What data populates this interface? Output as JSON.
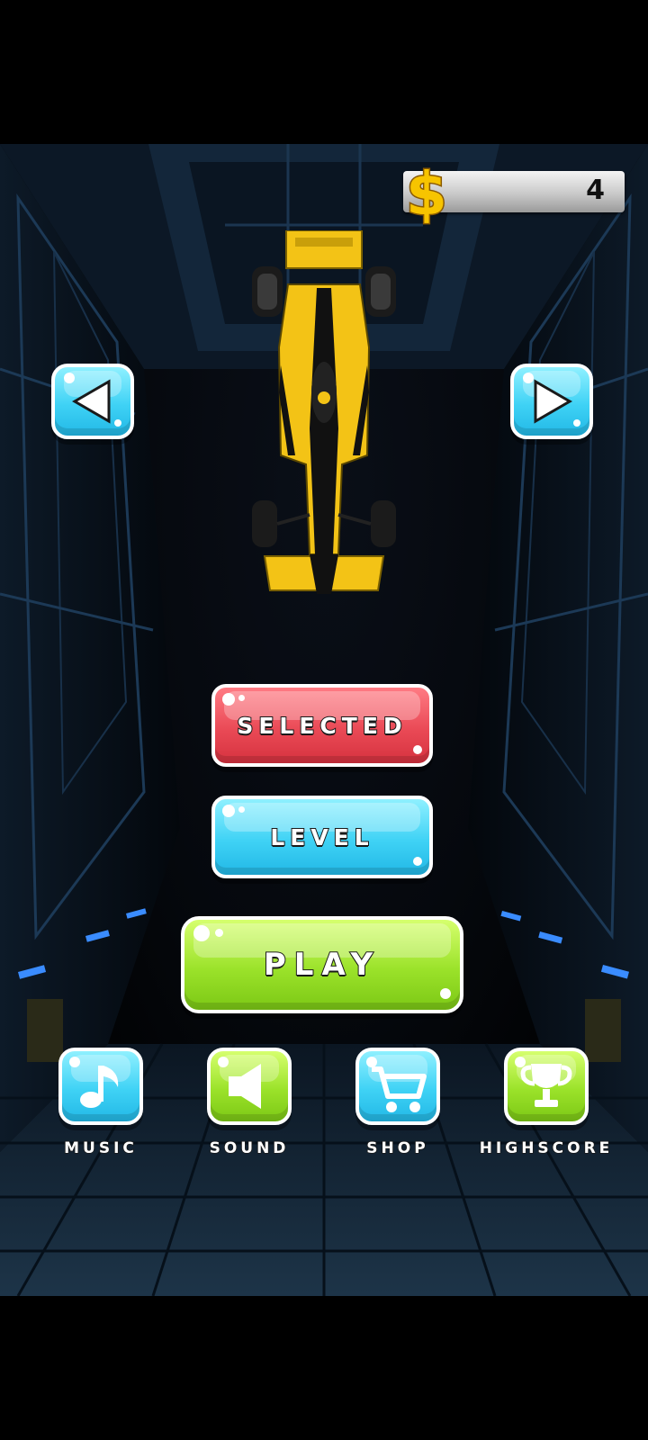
{
  "coins": {
    "value": "4",
    "icon": "dollar-icon"
  },
  "car_select": {
    "prev_icon": "arrow-left-icon",
    "next_icon": "arrow-right-icon",
    "car_icon": "formula-car-yellow"
  },
  "buttons": {
    "selected": "SELECTED",
    "level": "LEVEL",
    "play": "PLAY"
  },
  "menu": [
    {
      "label": "MUSIC",
      "icon": "music-note-icon"
    },
    {
      "label": "SOUND",
      "icon": "speaker-icon"
    },
    {
      "label": "SHOP",
      "icon": "cart-icon"
    },
    {
      "label": "HIGHSCORE",
      "icon": "trophy-icon"
    }
  ],
  "colors": {
    "red_button": "#ea4a56",
    "blue_button": "#3fd2f5",
    "green_button": "#9be22a",
    "car_yellow": "#f3c316"
  }
}
